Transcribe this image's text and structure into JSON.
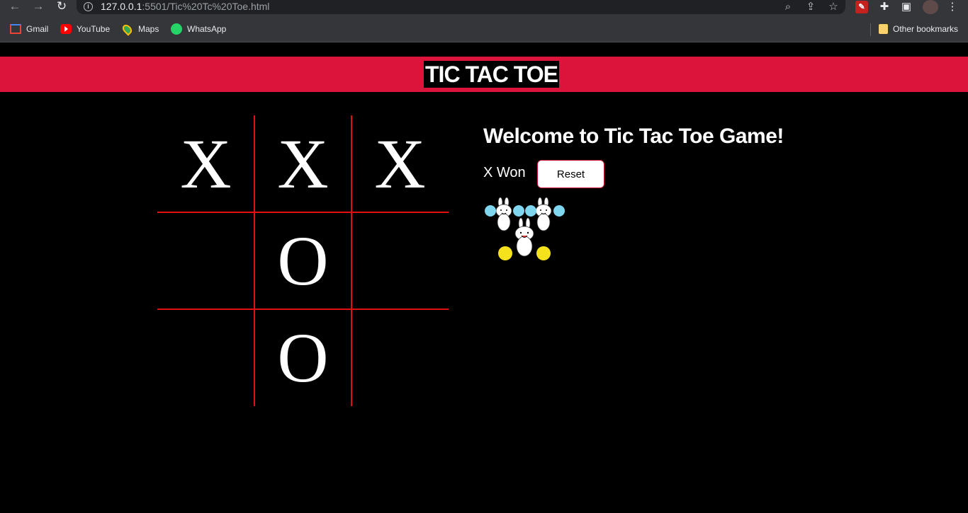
{
  "browser": {
    "url_host": "127.0.0.1",
    "url_rest": ":5501/Tic%20Tc%20Toe.html",
    "bookmarks": [
      {
        "label": "Gmail"
      },
      {
        "label": "YouTube"
      },
      {
        "label": "Maps"
      },
      {
        "label": "WhatsApp"
      }
    ],
    "other_bookmarks": "Other bookmarks"
  },
  "page": {
    "title": "TIC TAC TOE",
    "welcome": "Welcome to Tic Tac Toe Game!",
    "status": "X Won",
    "reset_label": "Reset",
    "header_color": "#dc143c",
    "line_color": "#e01010"
  },
  "board": {
    "cells": [
      "X",
      "X",
      "X",
      "",
      "O",
      "",
      "",
      "O",
      ""
    ]
  }
}
